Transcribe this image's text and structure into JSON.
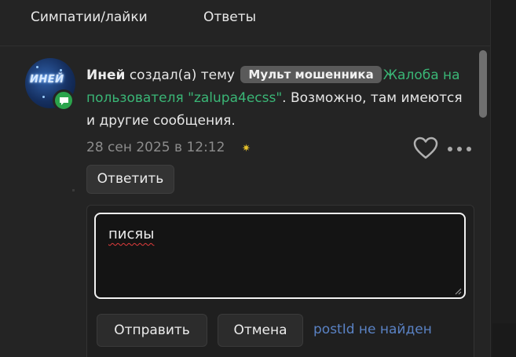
{
  "tabs": {
    "likes": "Симпатии/лайки",
    "replies": "Ответы"
  },
  "post": {
    "avatar_text": "ИНЕЙ",
    "username": "Иней",
    "action": "создал(а) тему",
    "badge": "Мульт мошенника",
    "thread_title": "Жалоба на пользователя \"zalupa4ecss\"",
    "suffix": ". Возможно, там имеются и другие сообщения.",
    "date": "28 сен 2025 в 12:12",
    "reply_label": "Ответить"
  },
  "reply_form": {
    "textarea_value": "писяы",
    "send_label": "Отправить",
    "cancel_label": "Отмена",
    "error_text": "postId не найден"
  },
  "colors": {
    "link": "#3ab676",
    "badge_bg": "#5a5a5a",
    "status_online": "#2ba44c",
    "error": "#5a82c4"
  },
  "icons": [
    "comment-icon",
    "sun-icon",
    "heart-icon",
    "more-icon"
  ]
}
